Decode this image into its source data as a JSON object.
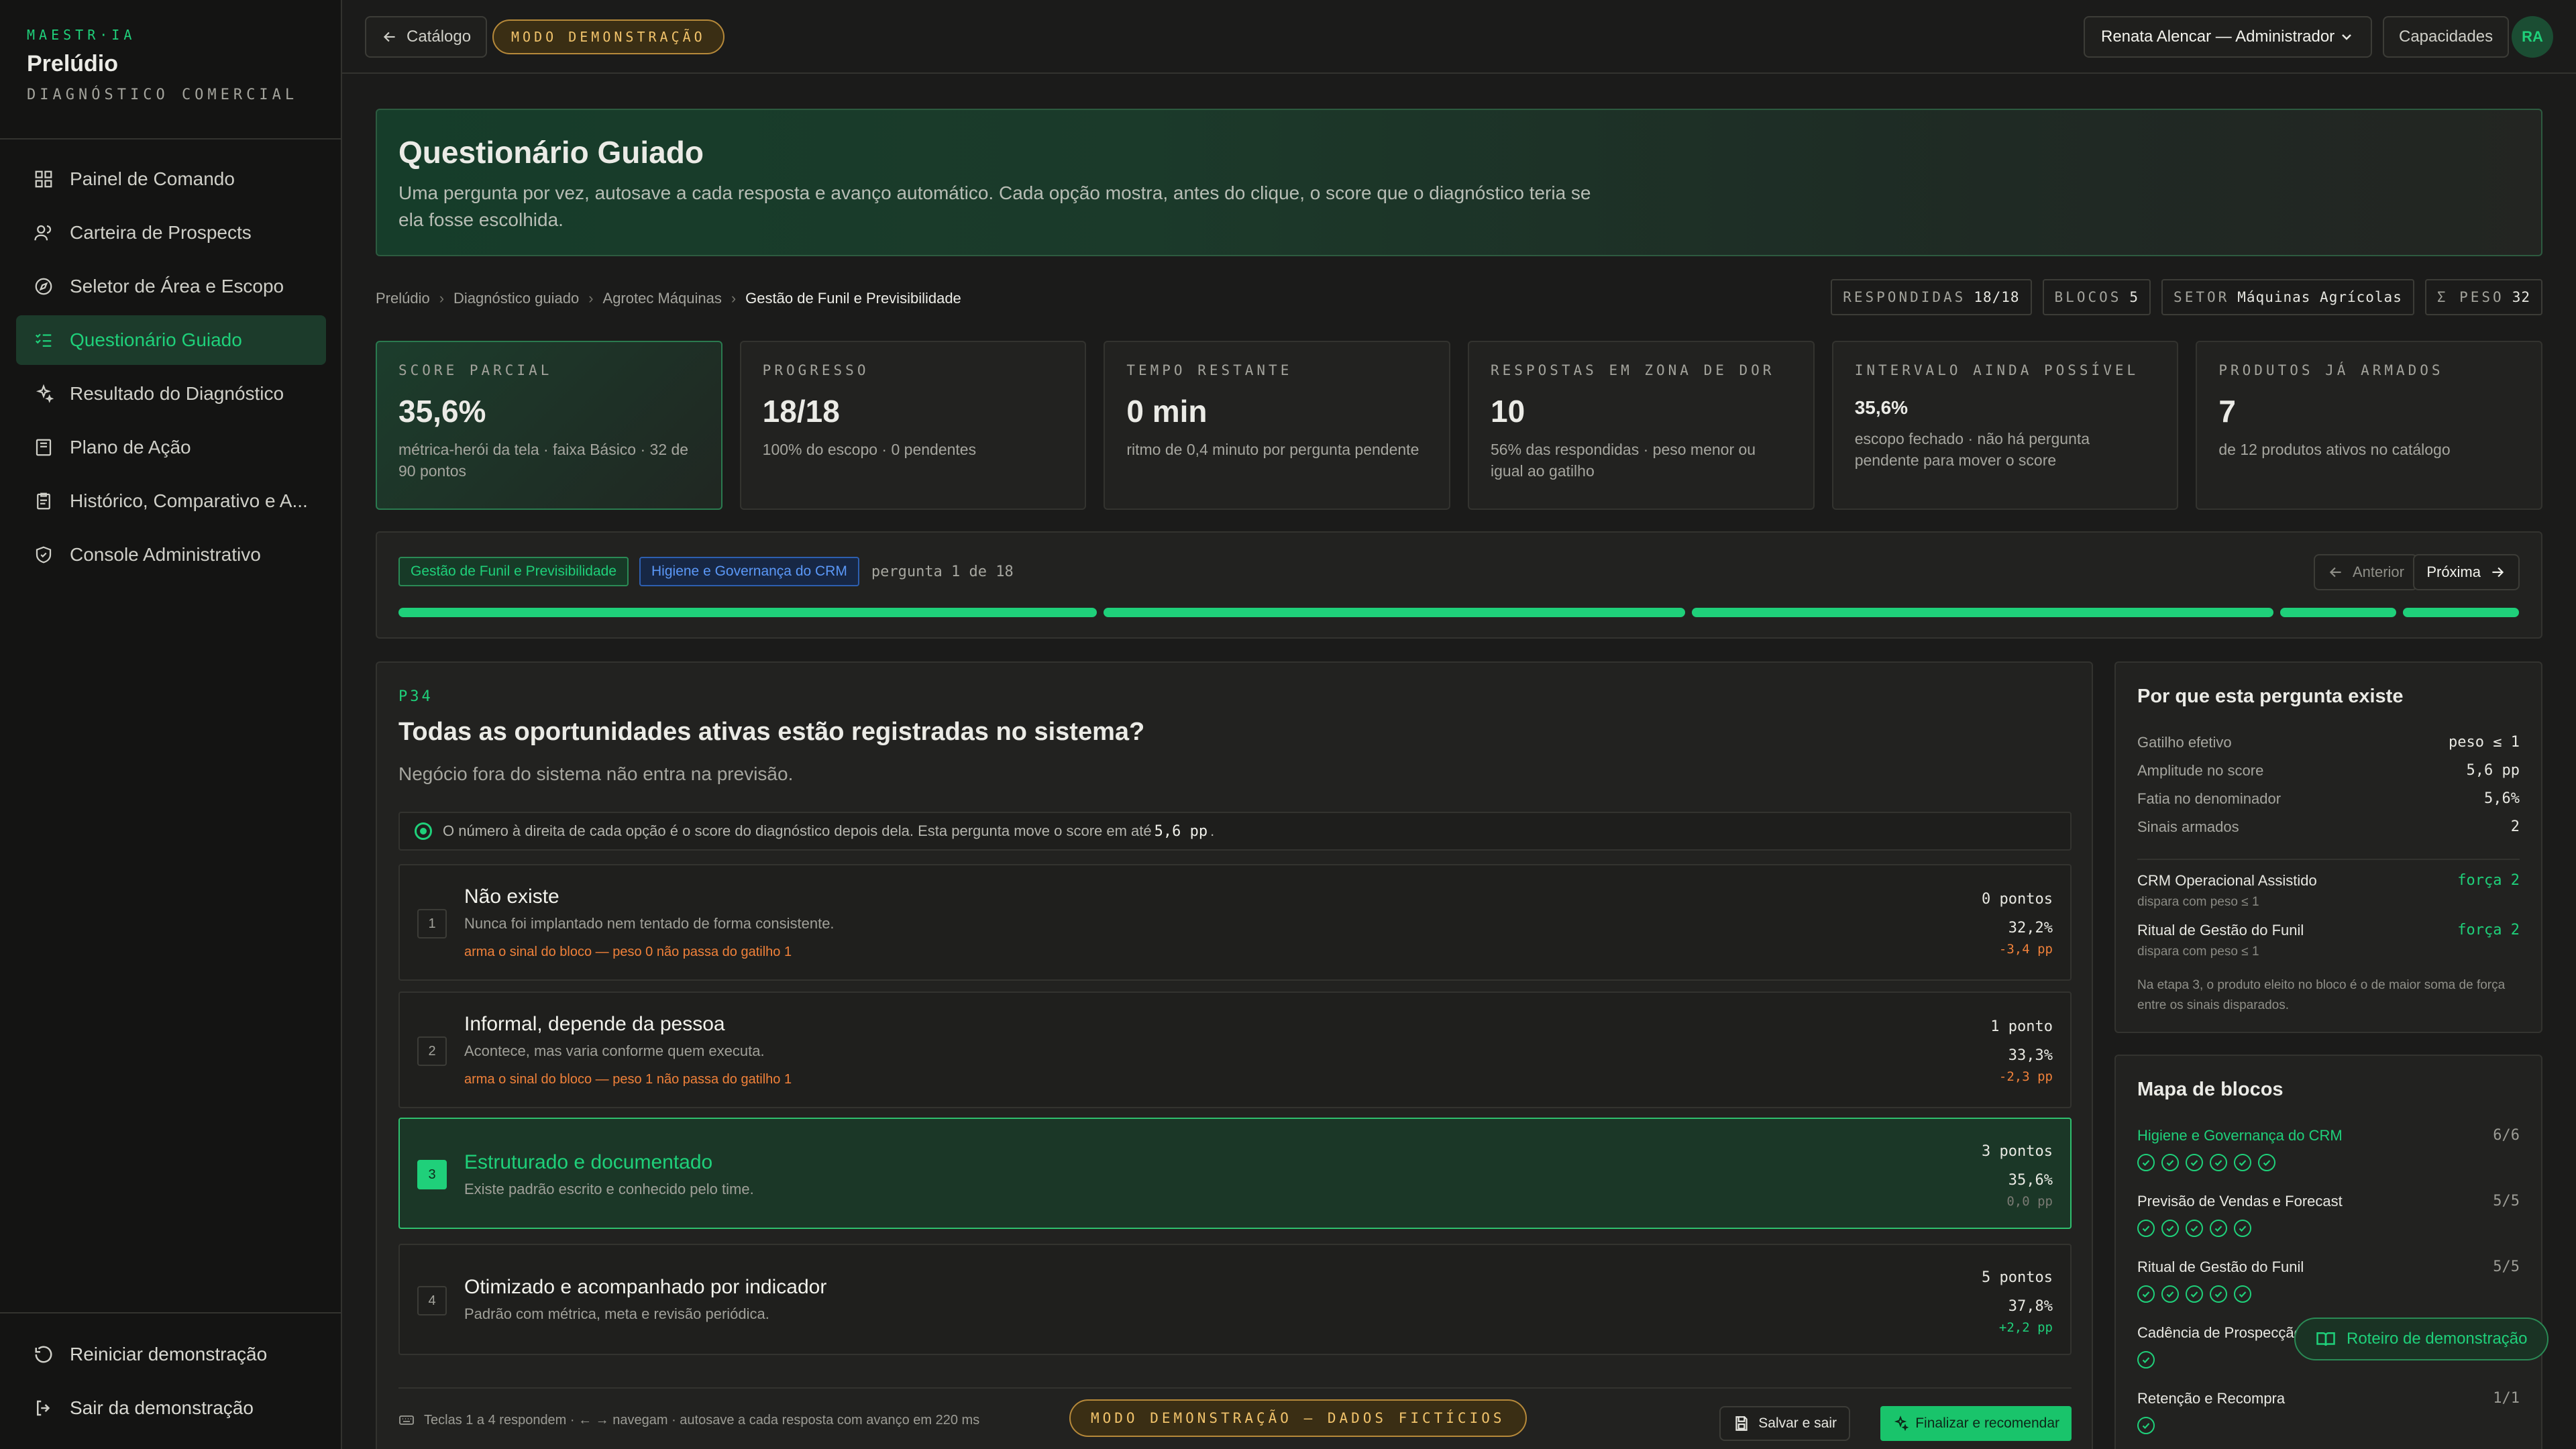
{
  "brand": {
    "small": "MAESTR·IA",
    "title": "Prelúdio",
    "subtitle": "DIAGNÓSTICO COMERCIAL"
  },
  "nav": [
    {
      "label": "Painel de Comando",
      "icon": "dashboard-icon"
    },
    {
      "label": "Carteira de Prospects",
      "icon": "users-icon"
    },
    {
      "label": "Seletor de Área e Escopo",
      "icon": "compass-icon"
    },
    {
      "label": "Questionário Guiado",
      "icon": "checklist-icon",
      "active": true
    },
    {
      "label": "Resultado do Diagnóstico",
      "icon": "sparkles-icon"
    },
    {
      "label": "Plano de Ação",
      "icon": "book-icon"
    },
    {
      "label": "Histórico, Comparativo e A...",
      "icon": "clipboard-icon"
    },
    {
      "label": "Console Administrativo",
      "icon": "shield-icon"
    }
  ],
  "nav_bottom": {
    "restart": "Reiniciar demonstração",
    "exit": "Sair da demonstração"
  },
  "topbar": {
    "back_label": "Catálogo",
    "demo_label": "MODO DEMONSTRAÇÃO",
    "user_select": "Renata Alencar — Administrador",
    "capabilities": "Capacidades",
    "avatar": "RA"
  },
  "hero": {
    "title": "Questionário Guiado",
    "desc": "Uma pergunta por vez, autosave a cada resposta e avanço automático. Cada opção mostra, antes do clique, o score que o diagnóstico teria se ela fosse escolhida."
  },
  "breadcrumbs": [
    "Prelúdio",
    "Diagnóstico guiado",
    "Agrotec Máquinas",
    "Gestão de Funil e Previsibilidade"
  ],
  "chips": [
    {
      "label": "RESPONDIDAS",
      "value": "18/18"
    },
    {
      "label": "BLOCOS",
      "value": "5"
    },
    {
      "label": "SETOR",
      "value": "Máquinas Agrícolas"
    },
    {
      "label": "Σ PESO",
      "value": "32"
    }
  ],
  "kpis": [
    {
      "label": "SCORE PARCIAL",
      "value": "35,6%",
      "sub": "métrica-herói da tela · faixa Básico · 32 de 90 pontos",
      "highlight": true
    },
    {
      "label": "PROGRESSO",
      "value": "18/18",
      "sub": "100% do escopo · 0 pendentes"
    },
    {
      "label": "TEMPO RESTANTE",
      "value": "0 min",
      "sub": "ritmo de 0,4 minuto por pergunta pendente"
    },
    {
      "label": "RESPOSTAS EM ZONA DE DOR",
      "value": "10",
      "sub": "56% das respondidas · peso menor ou igual ao gatilho"
    },
    {
      "label": "INTERVALO AINDA POSSÍVEL",
      "value": "35,6%",
      "sub": "escopo fechado · não há pergunta pendente para mover o score",
      "small": true
    },
    {
      "label": "PRODUTOS JÁ ARMADOS",
      "value": "7",
      "sub": "de 12 produtos ativos no catálogo"
    }
  ],
  "progress": {
    "tag_current": "Gestão de Funil e Previsibilidade",
    "tag_next": "Higiene e Governança do CRM",
    "counter": "pergunta 1 de 18",
    "prev": "Anterior",
    "next": "Próxima",
    "segments": [
      6,
      5,
      5,
      1,
      1
    ]
  },
  "question": {
    "id": "P34",
    "title": "Todas as oportunidades ativas estão registradas no sistema?",
    "desc": "Negócio fora do sistema não entra na previsão.",
    "note_pre": "O número à direita de cada opção é o score do diagnóstico depois dela. Esta pergunta move o score em até",
    "note_val": "5,6 pp",
    "options": [
      {
        "n": "1",
        "title": "Não existe",
        "desc": "Nunca foi implantado nem tentado de forma consistente.",
        "warn": "arma o sinal do bloco — peso 0 não passa do gatilho 1",
        "pts": "0 pontos",
        "score": "32,2%",
        "delta": "-3,4 pp",
        "dclass": "neg"
      },
      {
        "n": "2",
        "title": "Informal, depende da pessoa",
        "desc": "Acontece, mas varia conforme quem executa.",
        "warn": "arma o sinal do bloco — peso 1 não passa do gatilho 1",
        "pts": "1 ponto",
        "score": "33,3%",
        "delta": "-2,3 pp",
        "dclass": "neg"
      },
      {
        "n": "3",
        "title": "Estruturado e documentado",
        "desc": "Existe padrão escrito e conhecido pelo time.",
        "warn": "",
        "pts": "3 pontos",
        "score": "35,6%",
        "delta": "0,0 pp",
        "dclass": "zero",
        "selected": true
      },
      {
        "n": "4",
        "title": "Otimizado e acompanhado por indicador",
        "desc": "Padrão com métrica, meta e revisão periódica.",
        "warn": "",
        "pts": "5 pontos",
        "score": "37,8%",
        "delta": "+2,2 pp",
        "dclass": "pos"
      }
    ],
    "footer_hint": "Teclas 1 a 4 respondem · ← → navegam · autosave a cada resposta com avanço em 220 ms",
    "save_exit": "Salvar e sair",
    "finish": "Finalizar e recomendar"
  },
  "why": {
    "title": "Por que esta pergunta existe",
    "rows": [
      {
        "k": "Gatilho efetivo",
        "v": "peso ≤ 1"
      },
      {
        "k": "Amplitude no score",
        "v": "5,6 pp"
      },
      {
        "k": "Fatia no denominador",
        "v": "5,6%"
      },
      {
        "k": "Sinais armados",
        "v": "2"
      }
    ],
    "signals": [
      {
        "name": "CRM Operacional Assistido",
        "force": "força 2",
        "sub": "dispara com peso ≤ 1"
      },
      {
        "name": "Ritual de Gestão do Funil",
        "force": "força 2",
        "sub": "dispara com peso ≤ 1"
      }
    ],
    "note": "Na etapa 3, o produto eleito no bloco é o de maior soma de força entre os sinais disparados."
  },
  "blocks": {
    "title": "Mapa de blocos",
    "items": [
      {
        "name": "Higiene e Governança do CRM",
        "count": "6/6",
        "checks": 6,
        "current": true
      },
      {
        "name": "Previsão de Vendas e Forecast",
        "count": "5/5",
        "checks": 5
      },
      {
        "name": "Ritual de Gestão do Funil",
        "count": "5/5",
        "checks": 5
      },
      {
        "name": "Cadência de Prospecção",
        "count": "",
        "checks": 1
      },
      {
        "name": "Retenção e Recompra",
        "count": "1/1",
        "checks": 1
      }
    ]
  },
  "floating": {
    "roteiro": "Roteiro de demonstração",
    "demo_footer": "MODO DEMONSTRAÇÃO — DADOS FICTÍCIOS"
  }
}
